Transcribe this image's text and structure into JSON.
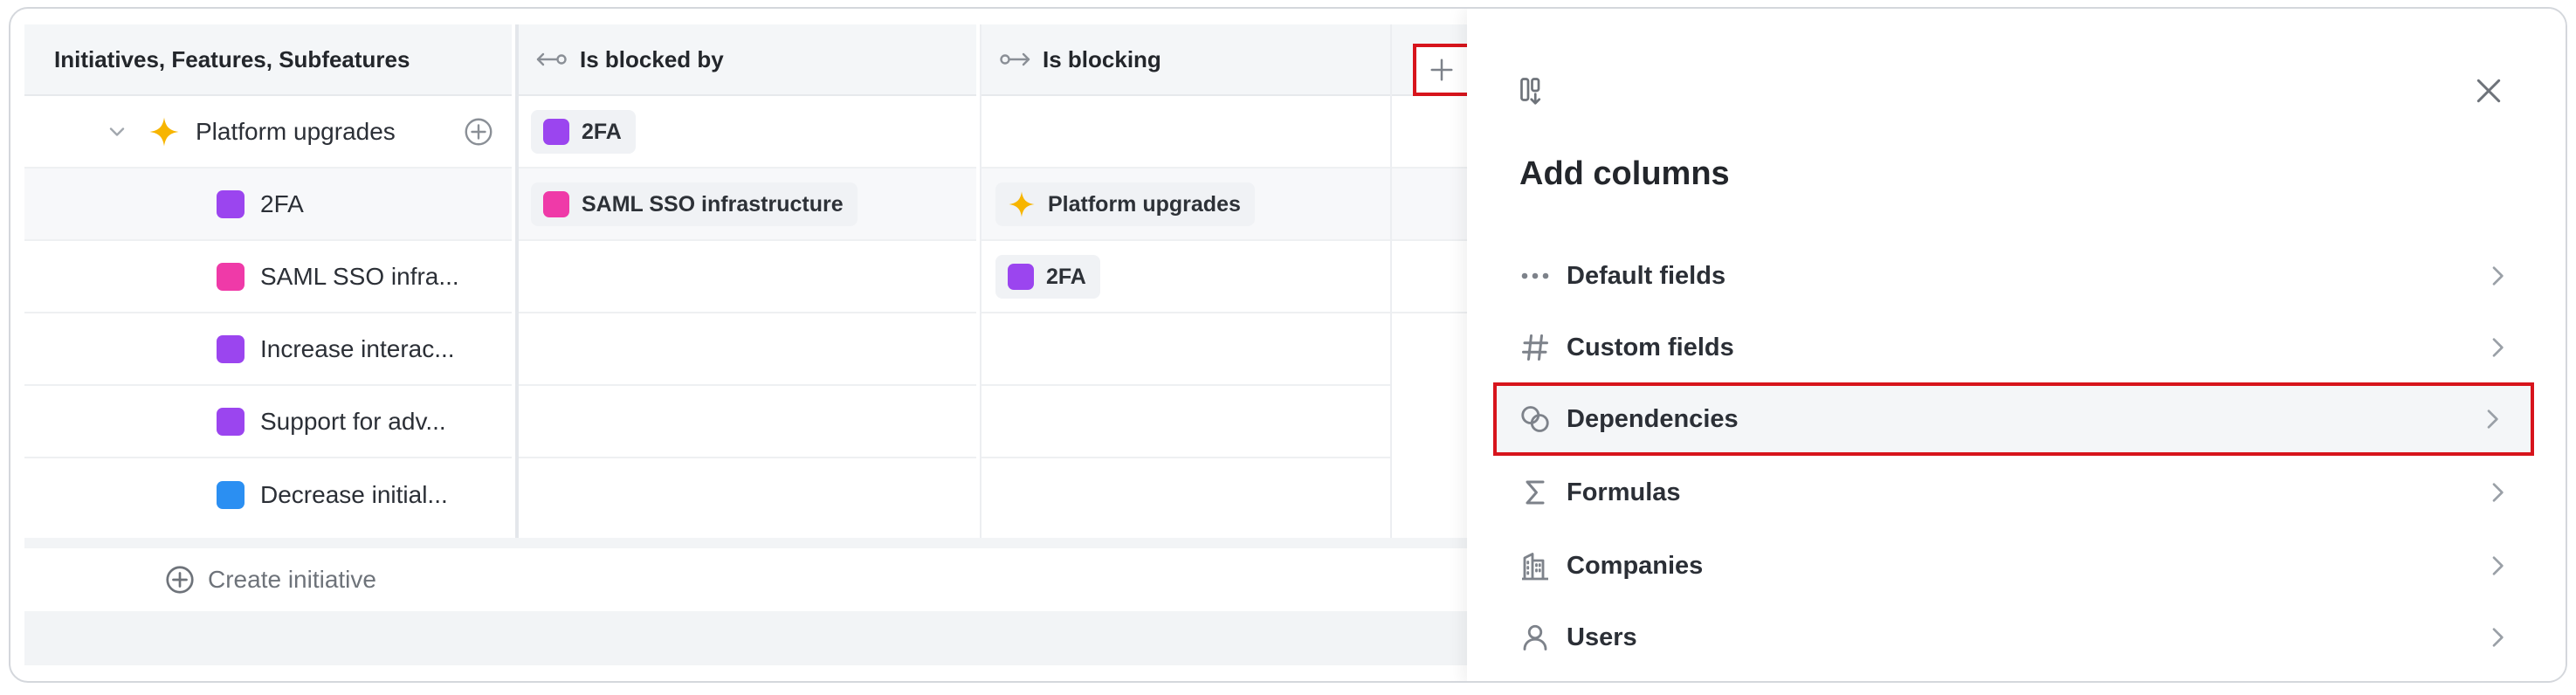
{
  "grid": {
    "columns": {
      "name": "Initiatives, Features, Subfeatures",
      "blocked_by": "Is blocked by",
      "blocking": "Is blocking"
    },
    "rows": [
      {
        "name": "Platform upgrades",
        "kind": "initiative",
        "blocked_by": [
          "2FA"
        ],
        "blocking": []
      },
      {
        "name": "2FA",
        "color": "#9b45ef",
        "blocked_by": [
          "SAML SSO infrastructure"
        ],
        "blocking": [
          "Platform upgrades"
        ]
      },
      {
        "name": "SAML SSO infra...",
        "color": "#ef3aa8",
        "blocked_by": [],
        "blocking": [
          "2FA"
        ]
      },
      {
        "name": "Increase interac...",
        "color": "#9b45ef",
        "blocked_by": [],
        "blocking": []
      },
      {
        "name": "Support for adv...",
        "color": "#9b45ef",
        "blocked_by": [],
        "blocking": []
      },
      {
        "name": "Decrease initial...",
        "color": "#2b8ff2",
        "blocked_by": [],
        "blocking": []
      }
    ],
    "chips": {
      "r0_blocked": "2FA",
      "r1_blocked": "SAML SSO infrastructure",
      "r1_blocking": "Platform upgrades",
      "r2_blocking": "2FA"
    },
    "create_label": "Create initiative"
  },
  "panel": {
    "title": "Add columns",
    "items": [
      {
        "label": "Default fields",
        "icon": "dots-icon"
      },
      {
        "label": "Custom fields",
        "icon": "hash-icon"
      },
      {
        "label": "Dependencies",
        "icon": "link-icon",
        "highlighted": true
      },
      {
        "label": "Formulas",
        "icon": "sigma-icon"
      },
      {
        "label": "Companies",
        "icon": "building-icon"
      },
      {
        "label": "Users",
        "icon": "user-icon"
      }
    ]
  },
  "colors": {
    "highlight": "#d7141c",
    "initiative_icon": "#f7b500"
  }
}
